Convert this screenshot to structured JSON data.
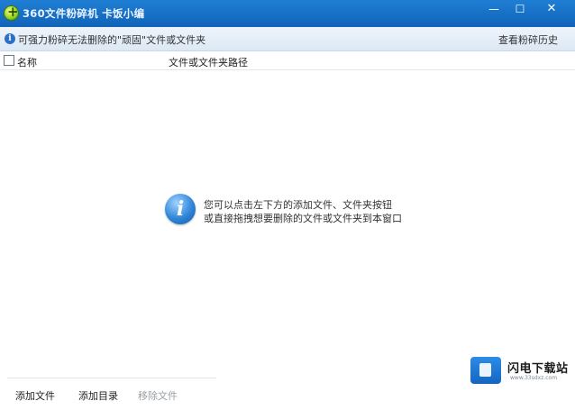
{
  "window": {
    "title": "360文件粉碎机  卡饭小编",
    "min_glyph": "—",
    "max_glyph": "☐",
    "close_glyph": "✕"
  },
  "infobar": {
    "icon_glyph": "i",
    "message": "可强力粉碎无法删除的\"顽固\"文件或文件夹",
    "history_link": "查看粉碎历史"
  },
  "list": {
    "columns": {
      "name": "名称",
      "path": "文件或文件夹路径"
    },
    "rows": []
  },
  "hint": {
    "icon_glyph": "i",
    "line1": "您可以点击左下方的添加文件、文件夹按钮",
    "line2": "或直接拖拽想要删除的文件或文件夹到本窗口"
  },
  "bottom": {
    "add_file": "添加文件",
    "add_dir": "添加目录",
    "remove_file": "移除文件"
  },
  "watermark": {
    "name": "闪电下载站",
    "url": "www.33sdxz.com"
  },
  "colors": {
    "titlebar": "#1570c6",
    "infobar": "#e6eef8",
    "disabled_text": "#9aa0a6"
  }
}
